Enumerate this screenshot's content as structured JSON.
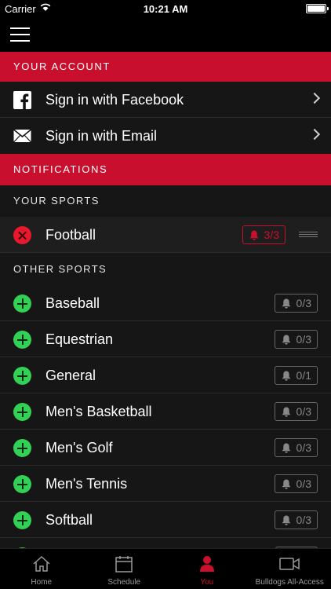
{
  "status_bar": {
    "carrier": "Carrier",
    "time": "10:21 AM"
  },
  "account": {
    "header": "YOUR ACCOUNT",
    "items": [
      {
        "label": "Sign in with Facebook",
        "icon": "facebook-icon"
      },
      {
        "label": "Sign in with Email",
        "icon": "mail-icon"
      }
    ]
  },
  "notifications": {
    "header": "NOTIFICATIONS"
  },
  "your_sports": {
    "header": "YOUR SPORTS",
    "items": [
      {
        "label": "Football",
        "badge": "3/3"
      }
    ]
  },
  "other_sports": {
    "header": "OTHER SPORTS",
    "items": [
      {
        "label": "Baseball",
        "badge": "0/3"
      },
      {
        "label": "Equestrian",
        "badge": "0/3"
      },
      {
        "label": "General",
        "badge": "0/1"
      },
      {
        "label": "Men's Basketball",
        "badge": "0/3"
      },
      {
        "label": "Men's Golf",
        "badge": "0/3"
      },
      {
        "label": "Men's Tennis",
        "badge": "0/3"
      },
      {
        "label": "Softball",
        "badge": "0/3"
      },
      {
        "label": "",
        "badge": ""
      }
    ]
  },
  "tabs": [
    {
      "label": "Home",
      "icon": "home-icon"
    },
    {
      "label": "Schedule",
      "icon": "calendar-icon"
    },
    {
      "label": "You",
      "icon": "person-icon",
      "active": true
    },
    {
      "label": "Bulldogs All-Access",
      "icon": "video-camera-icon"
    }
  ],
  "colors": {
    "accent": "#c8102e",
    "add": "#33d056",
    "remove": "#e8192c",
    "background": "#111111"
  }
}
